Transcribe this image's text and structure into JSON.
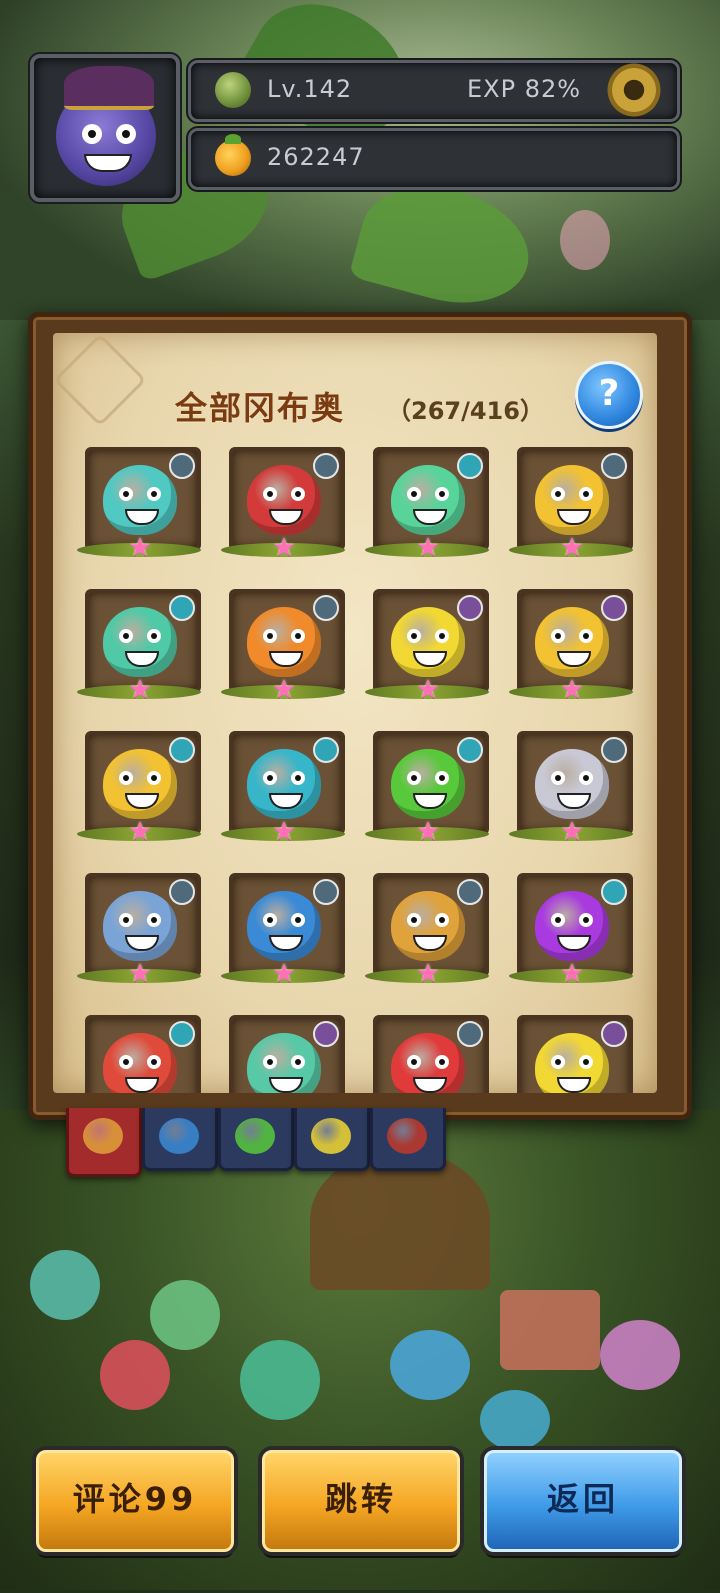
{
  "hud": {
    "level_label": "Lv.142",
    "exp_label": "EXP 82%",
    "currency_value": "262247",
    "icons": {
      "level": "leaf-level-icon",
      "currency": "fruit-icon",
      "settings": "gear-icon",
      "avatar": "octopus-pirate-avatar"
    }
  },
  "panel": {
    "title": "全部冈布奥",
    "count": "（267/416）",
    "help_label": "?"
  },
  "cards": [
    {
      "color": "#4fc9c2",
      "badge": "#4f6a7a"
    },
    {
      "color": "#d33a3a",
      "badge": "#4f6a7a"
    },
    {
      "color": "#58d49a",
      "badge": "#2fa5b5"
    },
    {
      "color": "#f2c232",
      "badge": "#4f6a7a"
    },
    {
      "color": "#4fc9a6",
      "badge": "#2fa5b5"
    },
    {
      "color": "#f08a2a",
      "badge": "#4f6a7a"
    },
    {
      "color": "#f2d832",
      "badge": "#7a4f9a"
    },
    {
      "color": "#f2c232",
      "badge": "#7a4f9a"
    },
    {
      "color": "#f2c232",
      "badge": "#2fa5b5"
    },
    {
      "color": "#38b6c9",
      "badge": "#2fa5b5"
    },
    {
      "color": "#58c93a",
      "badge": "#2fa5b5"
    },
    {
      "color": "#c9c9d6",
      "badge": "#4f6a7a"
    },
    {
      "color": "#7aa4d6",
      "badge": "#4f6a7a"
    },
    {
      "color": "#3a8ad6",
      "badge": "#4f6a7a"
    },
    {
      "color": "#e0a23a",
      "badge": "#4f6a7a"
    },
    {
      "color": "#a93ae0",
      "badge": "#2fa5b5"
    },
    {
      "color": "#e04a3a",
      "badge": "#2fa5b5"
    },
    {
      "color": "#58c9a6",
      "badge": "#7a4f9a"
    },
    {
      "color": "#e03a3a",
      "badge": "#4f6a7a"
    },
    {
      "color": "#f2d832",
      "badge": "#7a4f9a"
    }
  ],
  "card_rarity_icon": "pink-star-icon",
  "tabs": [
    {
      "name": "all",
      "icon_color": "#e0a23a",
      "active": true
    },
    {
      "name": "blue",
      "icon_color": "#3a8ad6",
      "active": false
    },
    {
      "name": "green",
      "icon_color": "#58c93a",
      "active": false
    },
    {
      "name": "yellow",
      "icon_color": "#f2d832",
      "active": false
    },
    {
      "name": "red",
      "icon_color": "#c0392b",
      "active": false
    }
  ],
  "buttons": {
    "comment": "评论99",
    "jump": "跳转",
    "back": "返回"
  }
}
